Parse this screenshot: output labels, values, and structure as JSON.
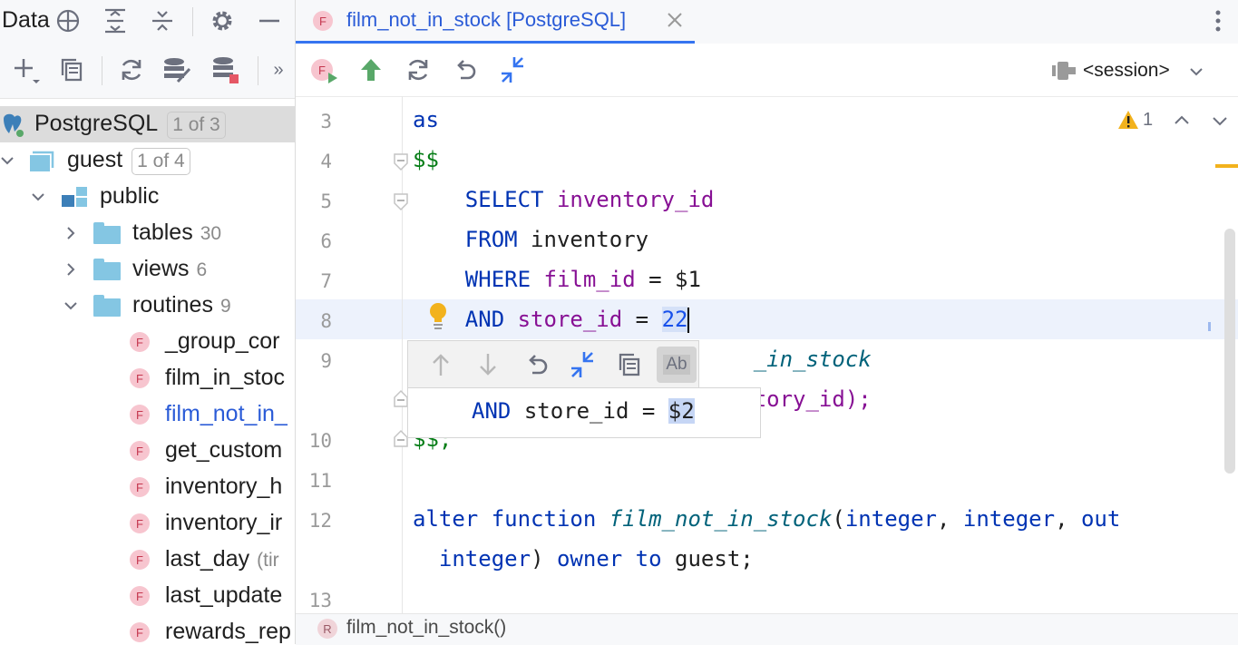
{
  "left_panel": {
    "title": "Data",
    "tree": {
      "root": {
        "label": "PostgreSQL",
        "pill": "1 of 3"
      },
      "db": {
        "label": "guest",
        "pill": "1 of 4"
      },
      "schema": {
        "label": "public"
      },
      "tables": {
        "label": "tables",
        "count": "30"
      },
      "views": {
        "label": "views",
        "count": "6"
      },
      "routines": {
        "label": "routines",
        "count": "9"
      },
      "items": [
        {
          "badge": "F",
          "label": "_group_cor"
        },
        {
          "badge": "F",
          "label": "film_in_stoc"
        },
        {
          "badge": "F",
          "label": "film_not_in_"
        },
        {
          "badge": "F",
          "label": "get_custom"
        },
        {
          "badge": "F",
          "label": "inventory_h"
        },
        {
          "badge": "F",
          "label": "inventory_ir"
        },
        {
          "badge": "F",
          "label": "last_day",
          "extra": "(tir"
        },
        {
          "badge": "F",
          "label": "last_update"
        },
        {
          "badge": "F",
          "label": "rewards_rep"
        }
      ]
    }
  },
  "editor": {
    "tab": {
      "badge": "F",
      "label": "film_not_in_stock [PostgreSQL]"
    },
    "session_label": "<session>",
    "warning_count": "1",
    "line_numbers": [
      "3",
      "4",
      "5",
      "6",
      "7",
      "8",
      "9",
      "10",
      "11",
      "12",
      "13"
    ],
    "code": {
      "l3": "as",
      "l4": "$$",
      "l5_kw": "SELECT",
      "l5_id": "inventory_id",
      "l6_kw": "FROM",
      "l6_id": "inventory",
      "l7_kw": "WHERE",
      "l7_id": "film_id",
      "l7_rest": "= $1",
      "l8_kw": "AND",
      "l8_id": "store_id",
      "l8_op": "=",
      "l8_num": "22",
      "l9_visible": "_in_stock",
      "l9b_visible": "tory_id);",
      "l10": "$$;",
      "l12_kw1": "alter",
      "l12_kw2": "function",
      "l12_fn": "film_not_in_stock",
      "l12_paren": "(",
      "l12_t1": "integer",
      "l12_comma": ",",
      "l12_t2": "integer",
      "l12_kw3": "out",
      "l12b_t": "integer",
      "l12b_paren": ")",
      "l12b_kw1": "owner",
      "l12b_kw2": "to",
      "l12b_id": "guest;"
    },
    "popup": {
      "kw": "AND",
      "id": "store_id",
      "op": "=",
      "param": "$2",
      "ab_label": "Ab"
    },
    "status": {
      "badge": "R",
      "label": "film_not_in_stock()"
    }
  }
}
